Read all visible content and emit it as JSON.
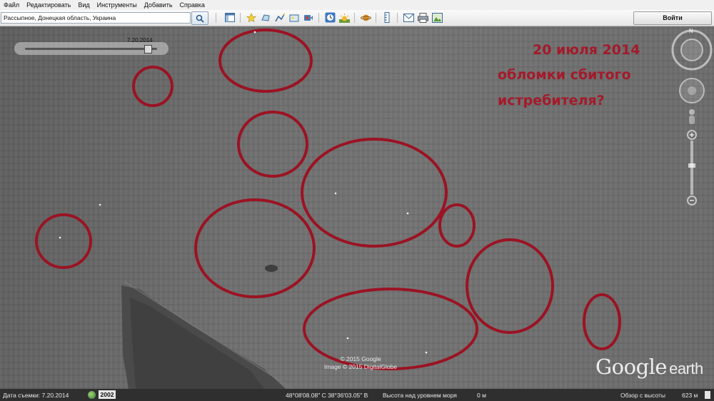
{
  "menu": {
    "items": [
      "Файл",
      "Редактировать",
      "Вид",
      "Инструменты",
      "Добавить",
      "Справка"
    ]
  },
  "search": {
    "value": "Рассыпное, Донецкая область, Украина",
    "go_label": "Войти"
  },
  "toolbar": {
    "icons": [
      "sidebar-icon",
      "placemark-icon",
      "polygon-icon",
      "path-icon",
      "image-overlay-icon",
      "record-tour-icon",
      "historical-imagery-icon",
      "sunlight-icon",
      "planets-icon",
      "ruler-icon",
      "email-icon",
      "print-icon",
      "save-image-icon"
    ]
  },
  "time_slider": {
    "date_label": "7.20.2014",
    "position": 0.93
  },
  "annotation": {
    "date_text": "20 июля 2014",
    "line1": "обломки сбитого",
    "line2": "истребителя?",
    "circle_color": "#9b1323",
    "text_color": "#a41a2a"
  },
  "copyright": {
    "line1": "© 2015 Google",
    "line2": "Image © 2015 DigitalGlobe"
  },
  "logo": {
    "brand": "Google",
    "product": "earth"
  },
  "status": {
    "imagery_date": "Дата съемки: 7.20.2014",
    "year_badge": "2002",
    "coords": "48°08'08.08\" С  38°36'03.05\" В",
    "elevation_label": "Высота над уровнем моря",
    "elevation_value": "0 м",
    "eye_alt_label": "Обзор с высоты",
    "eye_alt_value": "623 м"
  }
}
